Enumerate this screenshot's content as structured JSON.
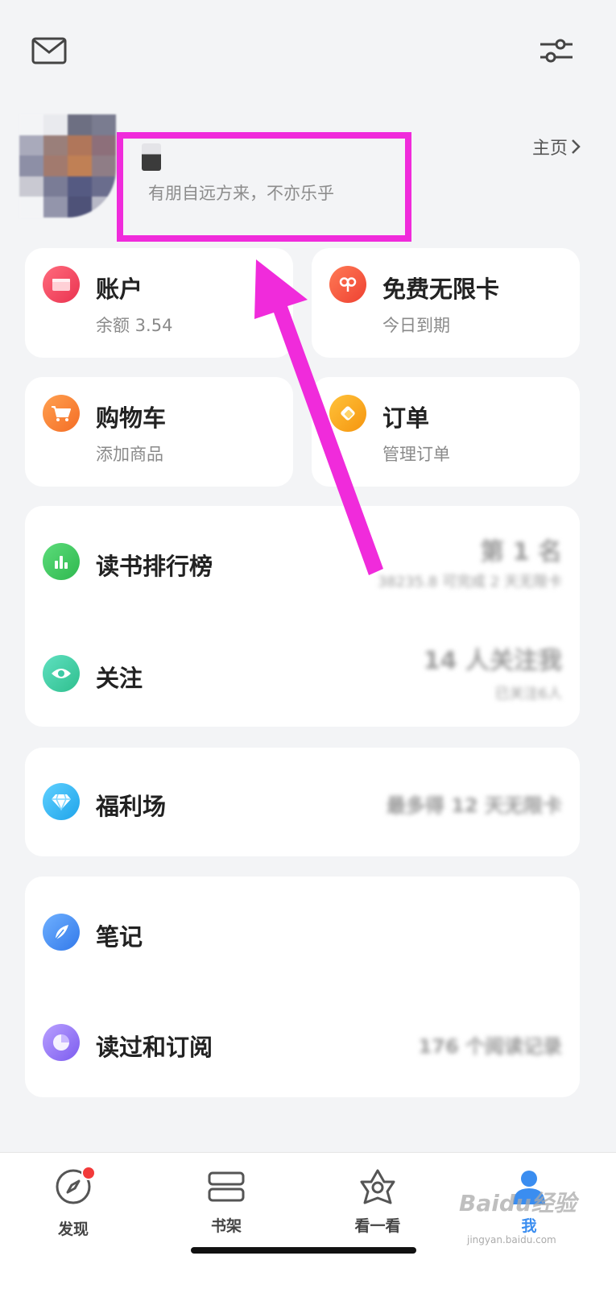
{
  "profile": {
    "name": "",
    "motto": "有朋自远方来，不亦乐乎",
    "homepage_label": "主页"
  },
  "tiles": {
    "account": {
      "title": "账户",
      "sub": "余额 3.54",
      "color": "#f0485f"
    },
    "free_card": {
      "title": "免费无限卡",
      "sub": "今日到期",
      "color": "#f2553c"
    },
    "cart": {
      "title": "购物车",
      "sub": "添加商品",
      "color": "#f7832f"
    },
    "orders": {
      "title": "订单",
      "sub": "管理订单",
      "color": "#f8a81d"
    }
  },
  "menu": {
    "ranking": {
      "label": "读书排行榜",
      "value": "第 1 名",
      "detail": "38235.8 可完成 2 天无限卡",
      "color": "#38c85a"
    },
    "follow": {
      "label": "关注",
      "value": "14 人关注我",
      "detail": "已关注6人",
      "color": "#3cc9a4"
    },
    "welfare": {
      "label": "福利场",
      "value": "最多得 12 天无限卡",
      "color": "#32b4f0"
    },
    "notes": {
      "label": "笔记",
      "color": "#3f8cf0"
    },
    "history": {
      "label": "读过和订阅",
      "value": "176 个阅读记录",
      "color": "#9b7ef0"
    }
  },
  "tabbar": {
    "discover": "发现",
    "shelf": "书架",
    "look": "看一看",
    "me": "我"
  },
  "watermark": {
    "brand": "Baidu经验",
    "url": "jingyan.baidu.com"
  },
  "colors": {
    "highlight": "#f02bdb",
    "notification_dot": "#f23a3a",
    "active_tab": "#3a8df0"
  }
}
